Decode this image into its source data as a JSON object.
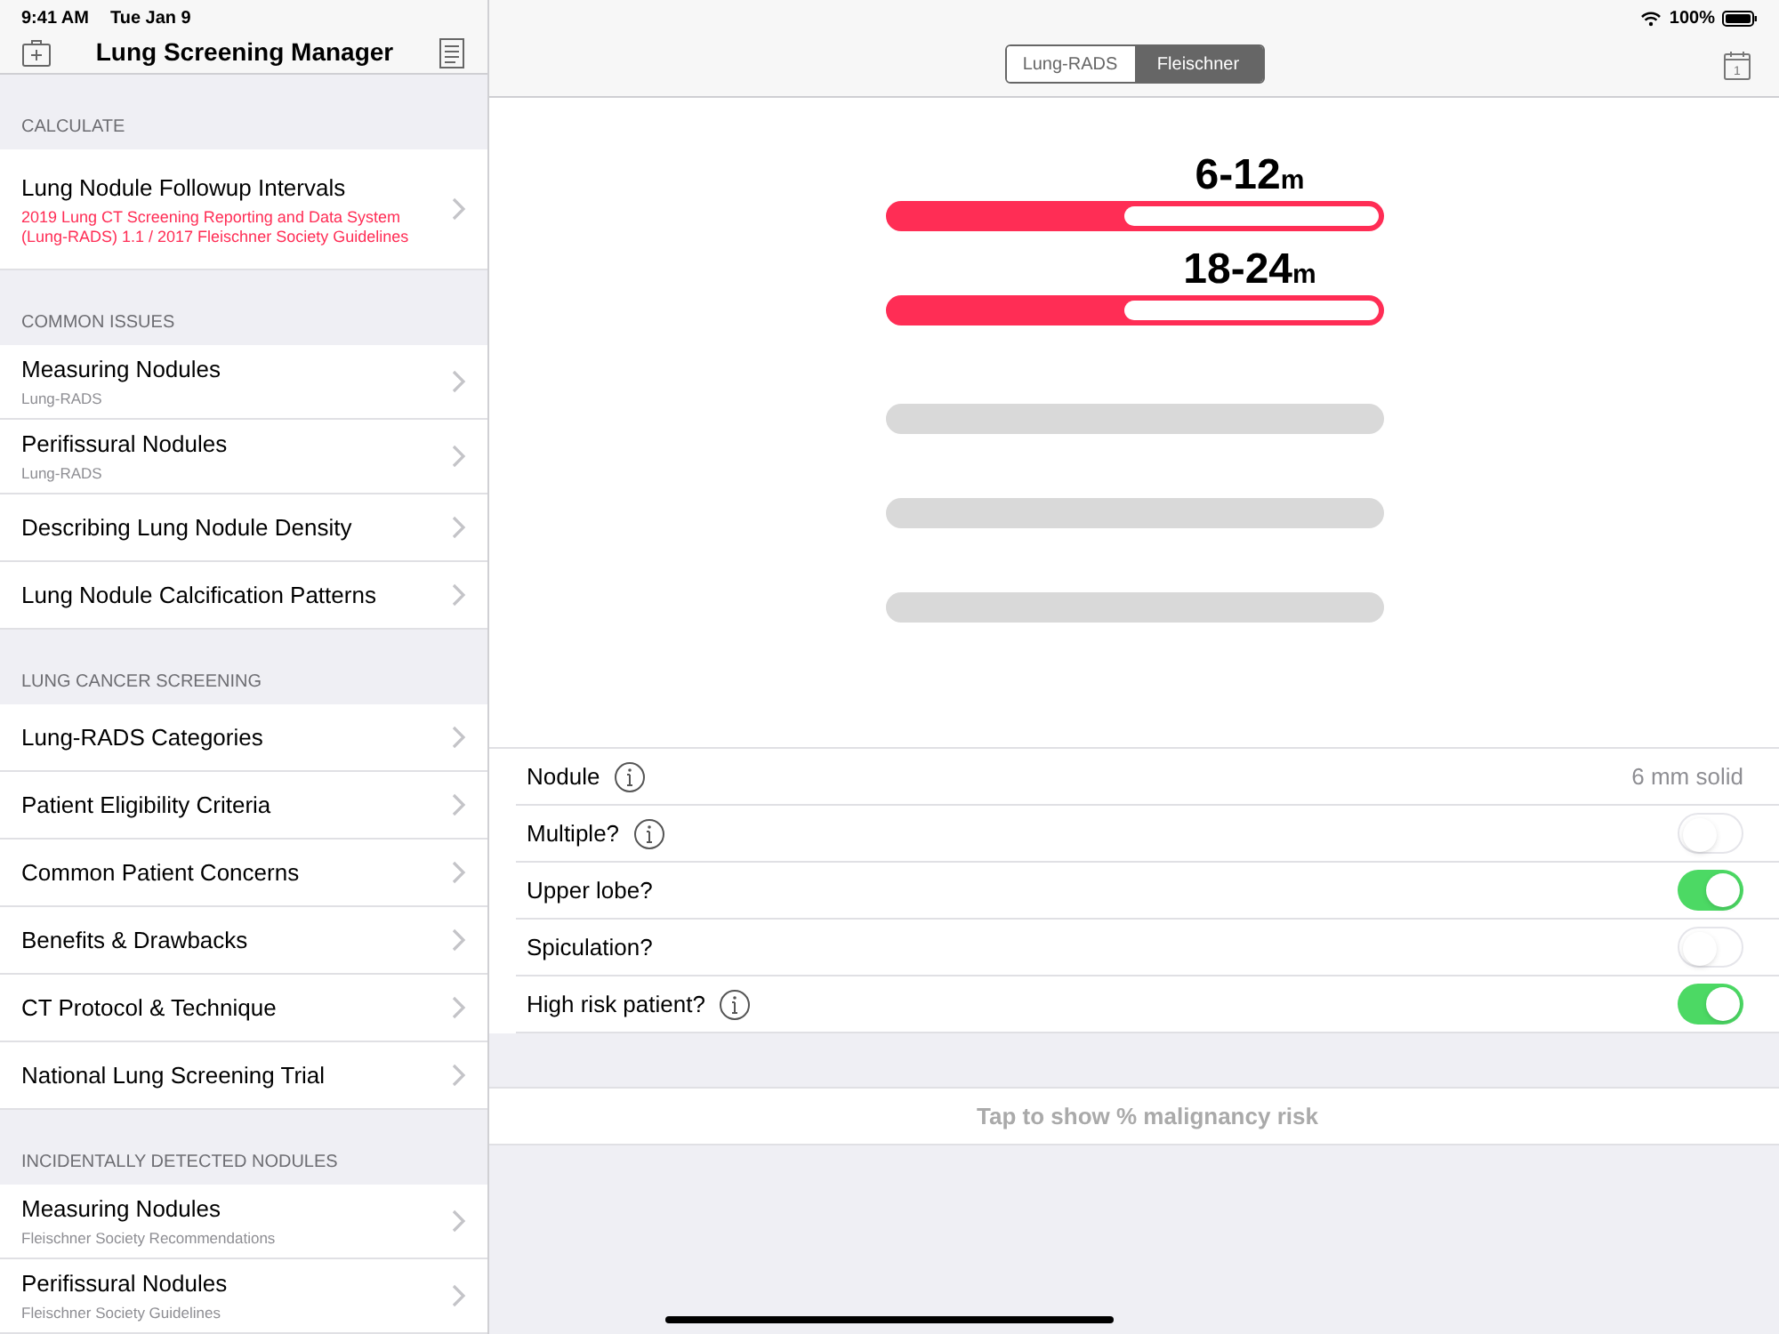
{
  "status_bar": {
    "time": "9:41 AM",
    "date": "Tue Jan 9",
    "battery": "100%"
  },
  "sidebar": {
    "title": "Lung Screening Manager",
    "sections": [
      {
        "header": "CALCULATE",
        "items": [
          {
            "title": "Lung Nodule Followup Intervals",
            "subtitle": "2019 Lung CT Screening Reporting and Data System (Lung-RADS) 1.1 / 2017 Fleischner Society Guidelines",
            "highlight": true
          }
        ]
      },
      {
        "header": "COMMON ISSUES",
        "items": [
          {
            "title": "Measuring Nodules",
            "subtitle": "Lung-RADS",
            "highlight": false
          },
          {
            "title": "Perifissural Nodules",
            "subtitle": "Lung-RADS",
            "highlight": false
          },
          {
            "title": "Describing Lung Nodule Density",
            "highlight": false
          },
          {
            "title": "Lung Nodule Calcification Patterns",
            "highlight": false
          }
        ]
      },
      {
        "header": "LUNG CANCER SCREENING",
        "items": [
          {
            "title": "Lung-RADS Categories",
            "highlight": false
          },
          {
            "title": "Patient Eligibility Criteria",
            "highlight": false
          },
          {
            "title": "Common Patient Concerns",
            "highlight": false
          },
          {
            "title": "Benefits & Drawbacks",
            "highlight": false
          },
          {
            "title": "CT Protocol & Technique",
            "highlight": false
          },
          {
            "title": "National Lung Screening Trial",
            "highlight": false
          }
        ]
      },
      {
        "header": "INCIDENTALLY DETECTED NODULES",
        "items": [
          {
            "title": "Measuring Nodules",
            "subtitle": "Fleischner Society Recommendations",
            "highlight": false
          },
          {
            "title": "Perifissural Nodules",
            "subtitle": "Fleischner Society Guidelines",
            "highlight": false
          }
        ]
      }
    ]
  },
  "calendar_day": "1",
  "segments": [
    {
      "label": "Lung-RADS",
      "selected": false
    },
    {
      "label": "Fleischner",
      "selected": true
    }
  ],
  "intervals": [
    {
      "kind": "result",
      "value": "6-12",
      "unit": "m",
      "level": 0.48
    },
    {
      "kind": "result",
      "value": "18-24",
      "unit": "m",
      "level": 0.48
    },
    {
      "kind": "empty"
    },
    {
      "kind": "empty"
    },
    {
      "kind": "empty"
    }
  ],
  "form": [
    {
      "kind": "value",
      "label": "Nodule",
      "info": true,
      "value": "6 mm solid"
    },
    {
      "kind": "toggle",
      "label": "Multiple?",
      "info": true,
      "on": false
    },
    {
      "kind": "toggle",
      "label": "Upper lobe?",
      "info": false,
      "on": true
    },
    {
      "kind": "toggle",
      "label": "Spiculation?",
      "info": false,
      "on": false
    },
    {
      "kind": "toggle",
      "label": "High risk patient?",
      "info": true,
      "on": true
    }
  ],
  "action": "Tap to show % malignancy risk"
}
